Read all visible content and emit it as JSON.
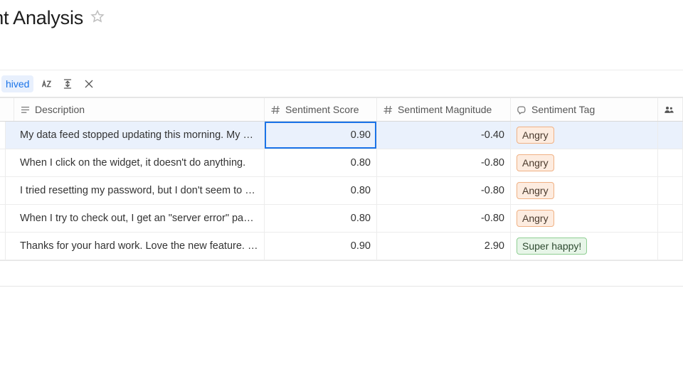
{
  "title": "timent Analysis",
  "toolbar": {
    "chip": "hived"
  },
  "columns": {
    "description": "Description",
    "sentiment_score": "Sentiment Score",
    "sentiment_magnitude": "Sentiment Magnitude",
    "sentiment_tag": "Sentiment Tag"
  },
  "rows": [
    {
      "description": "My data feed stopped updating this morning. My …",
      "score": "0.90",
      "magnitude": "-0.40",
      "tag": "Angry",
      "tag_class": "tag-angry",
      "selected": true
    },
    {
      "description": "When I click on the widget, it doesn't do anything.",
      "score": "0.80",
      "magnitude": "-0.80",
      "tag": "Angry",
      "tag_class": "tag-angry",
      "selected": false
    },
    {
      "description": "I tried resetting my password, but I don't seem to …",
      "score": "0.80",
      "magnitude": "-0.80",
      "tag": "Angry",
      "tag_class": "tag-angry",
      "selected": false
    },
    {
      "description": "When I try to check out, I get an \"server error\" pag…",
      "score": "0.80",
      "magnitude": "-0.80",
      "tag": "Angry",
      "tag_class": "tag-angry",
      "selected": false
    },
    {
      "description": "Thanks for your hard work. Love the new feature. …",
      "score": "0.90",
      "magnitude": "2.90",
      "tag": "Super happy!",
      "tag_class": "tag-happy",
      "selected": false
    }
  ]
}
